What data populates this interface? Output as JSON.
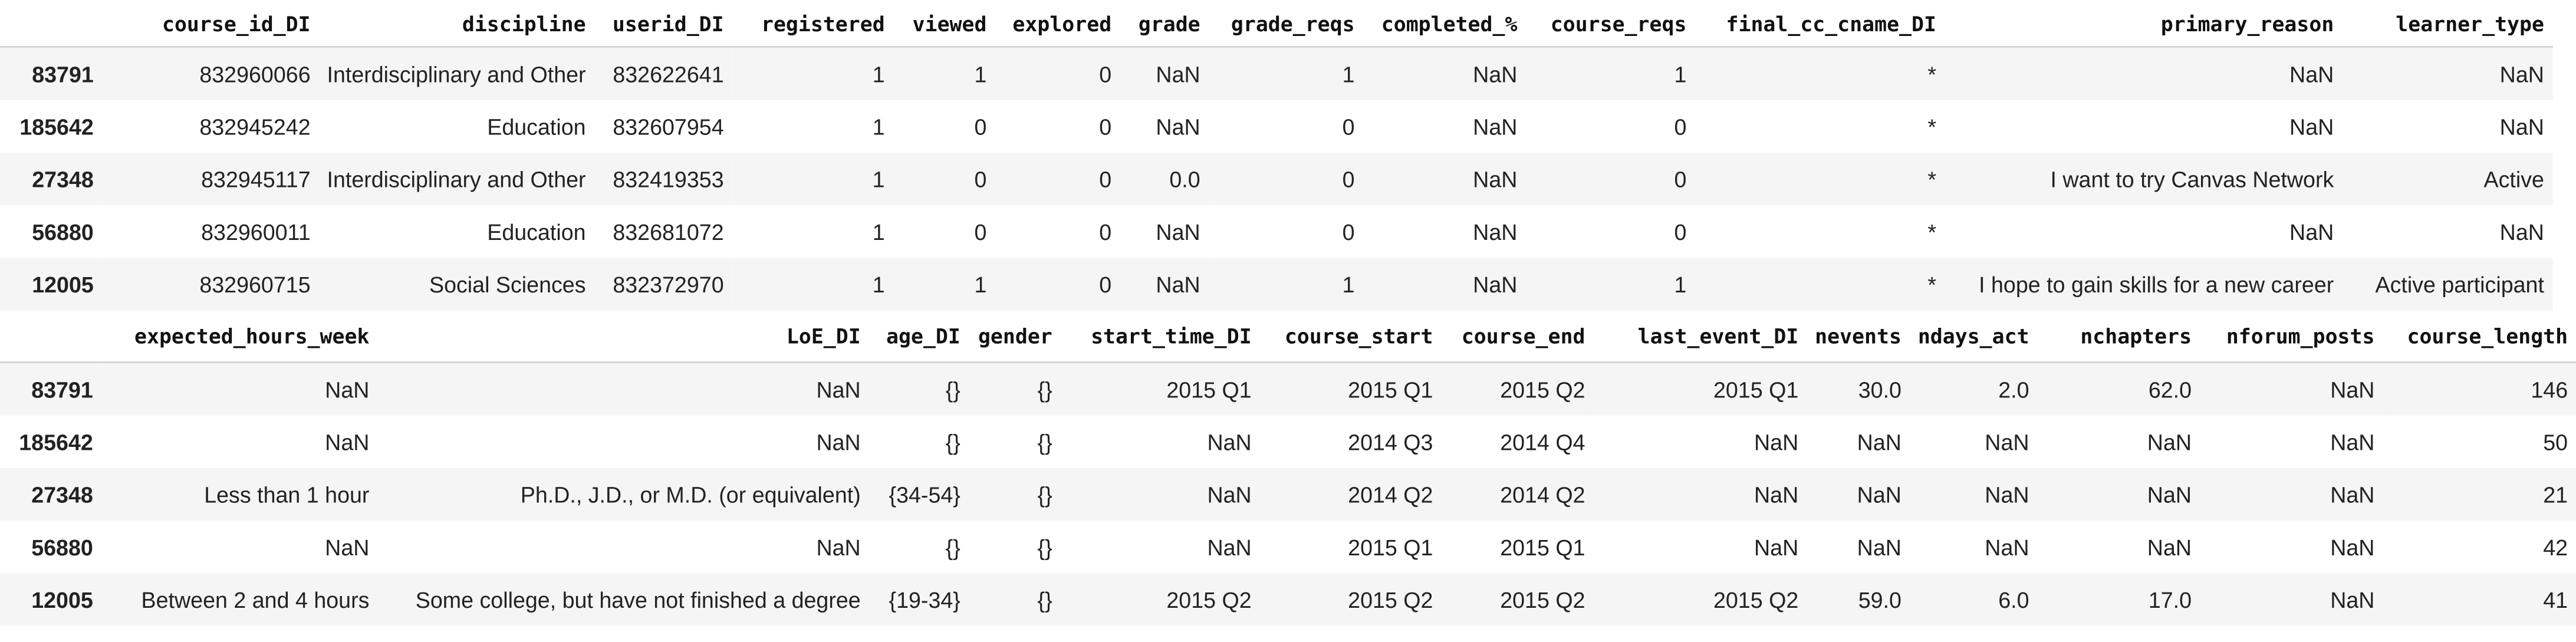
{
  "tables": [
    {
      "columns": [
        "",
        "course_id_DI",
        "discipline",
        "userid_DI",
        "registered",
        "viewed",
        "explored",
        "grade",
        "grade_reqs",
        "completed_%",
        "course_reqs",
        "final_cc_cname_DI",
        "primary_reason",
        "learner_type"
      ],
      "rows": [
        [
          "83791",
          "832960066",
          "Interdisciplinary and Other",
          "832622641",
          "1",
          "1",
          "0",
          "NaN",
          "1",
          "NaN",
          "1",
          "*",
          "NaN",
          "NaN"
        ],
        [
          "185642",
          "832945242",
          "Education",
          "832607954",
          "1",
          "0",
          "0",
          "NaN",
          "0",
          "NaN",
          "0",
          "*",
          "NaN",
          "NaN"
        ],
        [
          "27348",
          "832945117",
          "Interdisciplinary and Other",
          "832419353",
          "1",
          "0",
          "0",
          "0.0",
          "0",
          "NaN",
          "0",
          "*",
          "I want to try Canvas Network",
          "Active"
        ],
        [
          "56880",
          "832960011",
          "Education",
          "832681072",
          "1",
          "0",
          "0",
          "NaN",
          "0",
          "NaN",
          "0",
          "*",
          "NaN",
          "NaN"
        ],
        [
          "12005",
          "832960715",
          "Social Sciences",
          "832372970",
          "1",
          "1",
          "0",
          "NaN",
          "1",
          "NaN",
          "1",
          "*",
          "I hope to gain skills for a new career",
          "Active participant"
        ]
      ]
    },
    {
      "columns": [
        "",
        "expected_hours_week",
        "LoE_DI",
        "age_DI",
        "gender",
        "start_time_DI",
        "course_start",
        "course_end",
        "last_event_DI",
        "nevents",
        "ndays_act",
        "nchapters",
        "nforum_posts",
        "course_length"
      ],
      "rows": [
        [
          "83791",
          "NaN",
          "NaN",
          "{}",
          "{}",
          "2015 Q1",
          "2015 Q1",
          "2015 Q2",
          "2015 Q1",
          "30.0",
          "2.0",
          "62.0",
          "NaN",
          "146"
        ],
        [
          "185642",
          "NaN",
          "NaN",
          "{}",
          "{}",
          "NaN",
          "2014 Q3",
          "2014 Q4",
          "NaN",
          "NaN",
          "NaN",
          "NaN",
          "NaN",
          "50"
        ],
        [
          "27348",
          "Less than 1 hour",
          "Ph.D., J.D., or M.D. (or equivalent)",
          "{34-54}",
          "{}",
          "NaN",
          "2014 Q2",
          "2014 Q2",
          "NaN",
          "NaN",
          "NaN",
          "NaN",
          "NaN",
          "21"
        ],
        [
          "56880",
          "NaN",
          "NaN",
          "{}",
          "{}",
          "NaN",
          "2015 Q1",
          "2015 Q1",
          "NaN",
          "NaN",
          "NaN",
          "NaN",
          "NaN",
          "42"
        ],
        [
          "12005",
          "Between 2 and 4 hours",
          "Some college, but have not finished a degree",
          "{19-34}",
          "{}",
          "2015 Q2",
          "2015 Q2",
          "2015 Q2",
          "2015 Q2",
          "59.0",
          "6.0",
          "17.0",
          "NaN",
          "41"
        ]
      ]
    }
  ]
}
